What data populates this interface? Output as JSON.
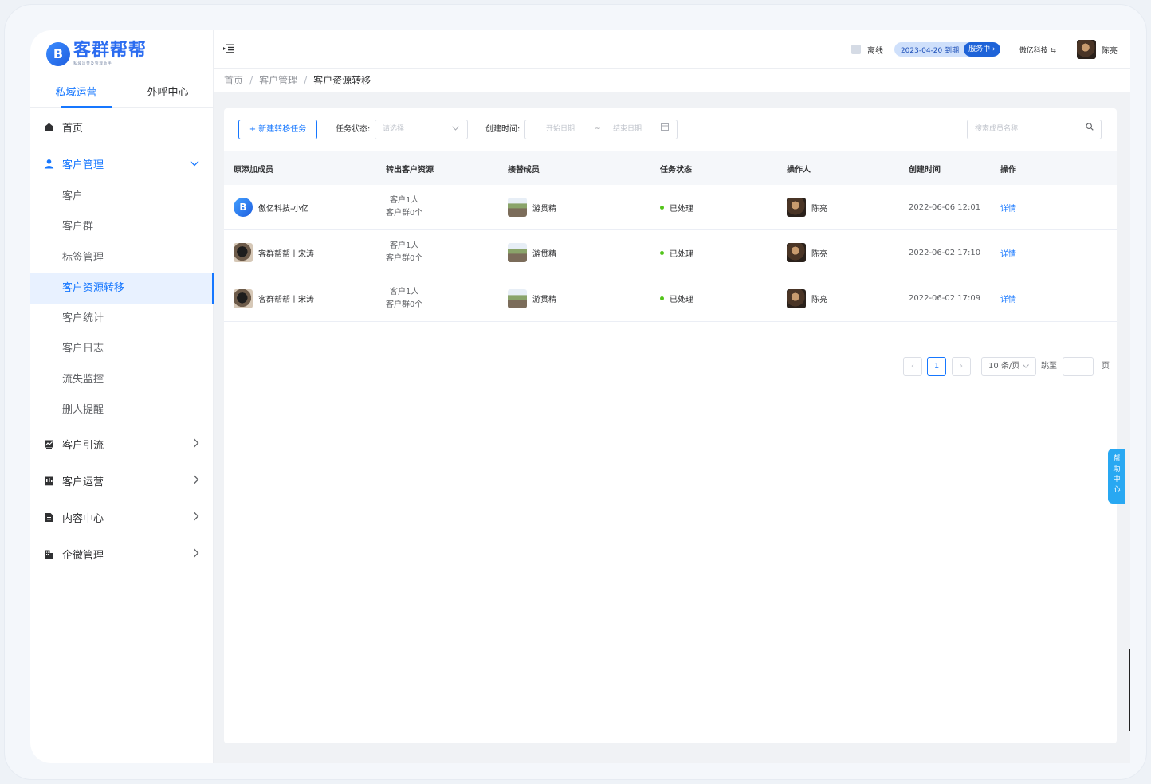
{
  "logo": {
    "title": "客群帮帮",
    "subtitle": "私域运营及管理助手"
  },
  "sidebar": {
    "tabs": [
      {
        "label": "私域运营"
      },
      {
        "label": "外呼中心"
      }
    ],
    "menu": {
      "home": "首页",
      "customer_mgmt": "客户管理",
      "sub": [
        "客户",
        "客户群",
        "标签管理",
        "客户资源转移",
        "客户统计",
        "客户日志",
        "流失监控",
        "删人提醒"
      ],
      "guide": "客户引流",
      "operation": "客户运营",
      "content": "内容中心",
      "wecom": "企微管理"
    }
  },
  "header": {
    "offline": "离线",
    "expire_date": "2023-04-20 到期",
    "service": "服务中 ›",
    "company": "傲亿科技 ⇆",
    "user": "陈亮"
  },
  "breadcrumb": {
    "home": "首页",
    "parent": "客户管理",
    "current": "客户资源转移",
    "sep": "/"
  },
  "toolbar": {
    "new_task": "+ 新建转移任务",
    "status_label": "任务状态:",
    "status_placeholder": "请选择",
    "created_label": "创建时间:",
    "start_placeholder": "开始日期",
    "range_sep": "~",
    "end_placeholder": "结束日期",
    "search_placeholder": "搜索成员名称"
  },
  "table": {
    "columns": [
      "原添加成员",
      "转出客户资源",
      "接替成员",
      "任务状态",
      "操作人",
      "创建时间",
      "操作"
    ],
    "rows": [
      {
        "member": "傲亿科技-小亿",
        "res1": "客户1人",
        "res2": "客户群0个",
        "successor": "游贯精",
        "status": "已处理",
        "operator": "陈亮",
        "time": "2022-06-06 12:01",
        "action": "详情"
      },
      {
        "member": "客群帮帮丨宋涛",
        "res1": "客户1人",
        "res2": "客户群0个",
        "successor": "游贯精",
        "status": "已处理",
        "operator": "陈亮",
        "time": "2022-06-02 17:10",
        "action": "详情"
      },
      {
        "member": "客群帮帮丨宋涛",
        "res1": "客户1人",
        "res2": "客户群0个",
        "successor": "游贯精",
        "status": "已处理",
        "operator": "陈亮",
        "time": "2022-06-02 17:09",
        "action": "详情"
      }
    ]
  },
  "pagination": {
    "prev": "‹",
    "page": "1",
    "next": "›",
    "size": "10 条/页",
    "jump_label": "跳至",
    "page_unit": "页"
  },
  "help": {
    "label": "帮助中心"
  },
  "colors": {
    "accent": "#1677ff",
    "success": "#52c41a",
    "help_tab": "#28a8f2"
  }
}
